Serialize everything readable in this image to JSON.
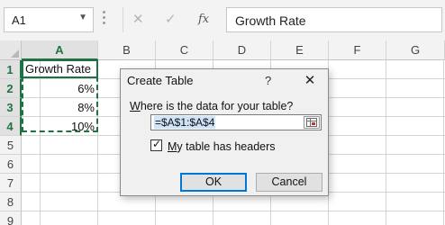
{
  "formula_bar": {
    "name_box": "A1",
    "name_box_dropdown": "▼",
    "cancel_glyph": "✕",
    "enter_glyph": "✓",
    "fx_label": "fx",
    "formula_value": "Growth Rate"
  },
  "grid": {
    "columns": [
      "A",
      "B",
      "C",
      "D",
      "E",
      "F",
      "G"
    ],
    "rows": [
      "1",
      "2",
      "3",
      "4",
      "5",
      "6",
      "7",
      "8",
      "9"
    ],
    "cells": {
      "a1": "Growth Rate",
      "a2": "6%",
      "a3": "8%",
      "a4": "10%"
    }
  },
  "dialog": {
    "title": "Create Table",
    "help": "?",
    "close": "✕",
    "prompt_underlined": "W",
    "prompt_rest": "here is the data for your table?",
    "range_value": "=$A$1:$A$4",
    "checkbox_glyph": "✓",
    "checkbox_label_underlined": "M",
    "checkbox_label_rest": "y table has headers",
    "ok_label": "OK",
    "cancel_label": "Cancel"
  },
  "colors": {
    "accent_green": "#217346",
    "dialog_focus": "#0078d7"
  }
}
